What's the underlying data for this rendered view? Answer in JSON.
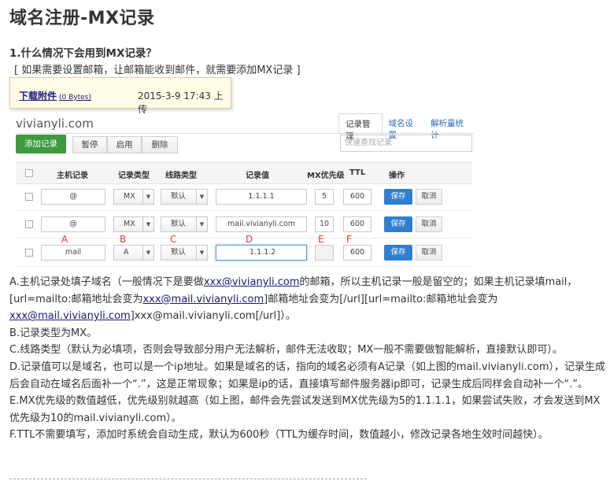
{
  "page": {
    "title": "域名注册-MX记录",
    "heading": "1.什么情况下会用到MX记录？",
    "subheading": "[ 如果需要设置邮箱，让邮箱能收到邮件，就需要添加MX记录 ]"
  },
  "attachment": {
    "link_label": "下载附件",
    "size": "(0 Bytes)",
    "upload_time": "2015-3-9 17:43 上传"
  },
  "panel": {
    "domain": "vivianyli.com",
    "tabs": [
      "记录管理",
      "域名设置",
      "解析量统计"
    ],
    "add_button": "添加记录",
    "toolbar": [
      "暂停",
      "启用",
      "删除"
    ],
    "search_placeholder": "快速查找记录",
    "columns": [
      "主机记录",
      "记录类型",
      "线路类型",
      "记录值",
      "MX优先级",
      "TTL",
      "操作"
    ],
    "rows": [
      {
        "host": "@",
        "type": "MX",
        "line": "默认",
        "value": "1.1.1.1",
        "mx": "5",
        "ttl": "600"
      },
      {
        "host": "@",
        "type": "MX",
        "line": "默认",
        "value": "mail.vivianyli.com",
        "mx": "10",
        "ttl": "600"
      },
      {
        "host": "mail",
        "type": "A",
        "line": "默认",
        "value": "1.1.1.2",
        "mx": "",
        "ttl": "600"
      }
    ],
    "save_label": "保存",
    "cancel_label": "取消",
    "letters": [
      "A",
      "B",
      "C",
      "D",
      "E",
      "F"
    ]
  },
  "explanations": {
    "a_1": "A.主机记录处填子域名（一般情况下是要做",
    "a_link1": "xxx@vivianyli.com",
    "a_2": "的邮箱，所以主机记录一般是留空的；如果主机记录填mail，[url=mailto:邮箱地址会变为",
    "a_link2": "xxx@mail.vivianyli.com",
    "a_3": "]邮箱地址会变为[/url][url=mailto:邮箱地址会变为",
    "a_link3": "xxx@mail.vivianyli.com",
    "a_4": "]xxx@mail.vivianyli.com[/url]）。",
    "b": "B.记录类型为MX。",
    "c": "C.线路类型（默认为必填项，否则会导致部分用户无法解析，邮件无法收取；MX一般不需要做智能解析，直接默认即可）。",
    "d": "D.记录值可以是域名，也可以是一个ip地址。如果是域名的话，指向的域名必须有A记录（如上图的mail.vivianyli.com），记录生成后会自动在域名后面补一个“.”，这是正常现象；如果是ip的话，直接填写邮件服务器ip即可，记录生成后同样会自动补一个“.”。",
    "e": "E.MX优先级的数值越低，优先级别就越高（如上图，邮件会先尝试发送到MX优先级为5的1.1.1.1，如果尝试失败，才会发送到MX优先级为10的mail.vivianyli.com）。",
    "f": "F.TTL不需要填写，添加时系统会自动生成，默认为600秒（TTL为缓存时间，数值越小，修改记录各地生效时间越快）。"
  }
}
